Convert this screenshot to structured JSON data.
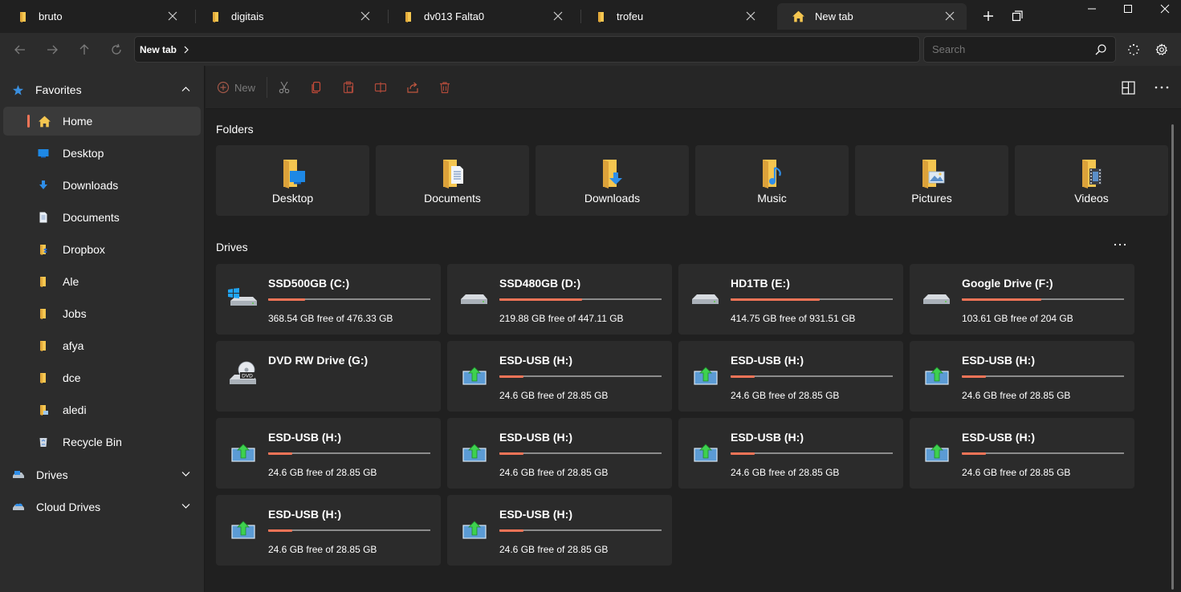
{
  "tabs": [
    {
      "label": "bruto",
      "active": false
    },
    {
      "label": "digitais",
      "active": false
    },
    {
      "label": "dv013 Falta0",
      "active": false
    },
    {
      "label": "trofeu",
      "active": false
    },
    {
      "label": "New tab",
      "active": true
    }
  ],
  "address": {
    "crumb": "New tab"
  },
  "search": {
    "placeholder": "Search"
  },
  "sidebar": {
    "favorites_label": "Favorites",
    "items": [
      {
        "label": "Home",
        "icon": "home-icon"
      },
      {
        "label": "Desktop",
        "icon": "desktop-icon"
      },
      {
        "label": "Downloads",
        "icon": "downloads-icon"
      },
      {
        "label": "Documents",
        "icon": "documents-icon"
      },
      {
        "label": "Dropbox",
        "icon": "dropbox-folder-icon"
      },
      {
        "label": "Ale",
        "icon": "folder-icon"
      },
      {
        "label": "Jobs",
        "icon": "folder-icon"
      },
      {
        "label": "afya",
        "icon": "folder-icon"
      },
      {
        "label": "dce",
        "icon": "folder-icon"
      },
      {
        "label": "aledi",
        "icon": "folder-icon"
      },
      {
        "label": "Recycle Bin",
        "icon": "recycle-bin-icon"
      }
    ],
    "drives_label": "Drives",
    "cloud_label": "Cloud Drives"
  },
  "toolbar": {
    "new_label": "New"
  },
  "main": {
    "folders_title": "Folders",
    "folders": [
      {
        "label": "Desktop",
        "overlay": "desktop"
      },
      {
        "label": "Documents",
        "overlay": "documents"
      },
      {
        "label": "Downloads",
        "overlay": "downloads"
      },
      {
        "label": "Music",
        "overlay": "music"
      },
      {
        "label": "Pictures",
        "overlay": "pictures"
      },
      {
        "label": "Videos",
        "overlay": "videos"
      }
    ],
    "drives_title": "Drives",
    "drives": [
      {
        "name": "SSD500GB (C:)",
        "free": "368.54 GB free of 476.33 GB",
        "used_fraction": 0.23,
        "icon": "windows-drive-icon"
      },
      {
        "name": "SSD480GB (D:)",
        "free": "219.88 GB free of 447.11 GB",
        "used_fraction": 0.51,
        "icon": "hard-drive-icon"
      },
      {
        "name": "HD1TB (E:)",
        "free": "414.75 GB free of 931.51 GB",
        "used_fraction": 0.55,
        "icon": "hard-drive-icon"
      },
      {
        "name": "Google Drive (F:)",
        "free": "103.61 GB free of 204 GB",
        "used_fraction": 0.49,
        "icon": "hard-drive-icon"
      },
      {
        "name": "DVD RW Drive (G:)",
        "free": "",
        "used_fraction": null,
        "icon": "dvd-drive-icon"
      },
      {
        "name": "ESD-USB (H:)",
        "free": "24.6 GB free of 28.85 GB",
        "used_fraction": 0.15,
        "icon": "usb-drive-icon"
      },
      {
        "name": "ESD-USB (H:)",
        "free": "24.6 GB free of 28.85 GB",
        "used_fraction": 0.15,
        "icon": "usb-drive-icon"
      },
      {
        "name": "ESD-USB (H:)",
        "free": "24.6 GB free of 28.85 GB",
        "used_fraction": 0.15,
        "icon": "usb-drive-icon"
      },
      {
        "name": "ESD-USB (H:)",
        "free": "24.6 GB free of 28.85 GB",
        "used_fraction": 0.15,
        "icon": "usb-drive-icon"
      },
      {
        "name": "ESD-USB (H:)",
        "free": "24.6 GB free of 28.85 GB",
        "used_fraction": 0.15,
        "icon": "usb-drive-icon"
      },
      {
        "name": "ESD-USB (H:)",
        "free": "24.6 GB free of 28.85 GB",
        "used_fraction": 0.15,
        "icon": "usb-drive-icon"
      },
      {
        "name": "ESD-USB (H:)",
        "free": "24.6 GB free of 28.85 GB",
        "used_fraction": 0.15,
        "icon": "usb-drive-icon"
      },
      {
        "name": "ESD-USB (H:)",
        "free": "24.6 GB free of 28.85 GB",
        "used_fraction": 0.15,
        "icon": "usb-drive-icon"
      },
      {
        "name": "ESD-USB (H:)",
        "free": "24.6 GB free of 28.85 GB",
        "used_fraction": 0.15,
        "icon": "usb-drive-icon"
      }
    ]
  },
  "colors": {
    "accent": "#f47457",
    "folder": "#f5c650",
    "background": "#202020",
    "card": "#2b2b2b"
  }
}
